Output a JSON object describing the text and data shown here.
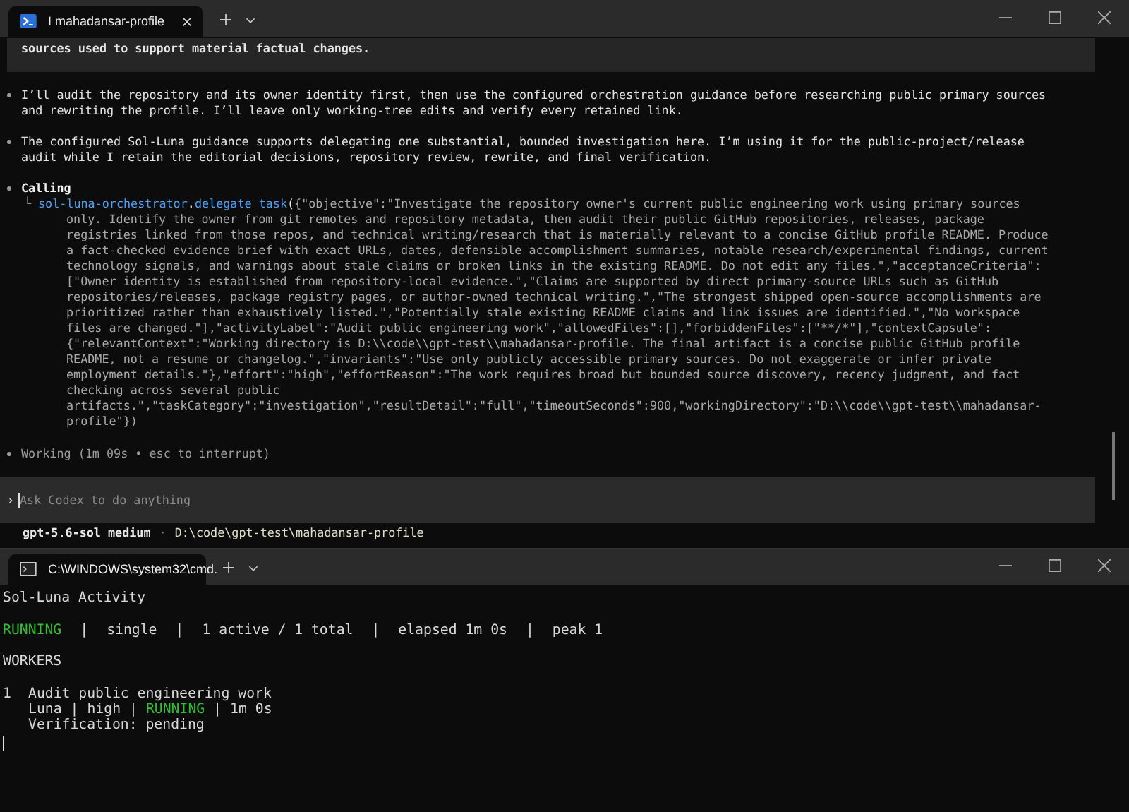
{
  "top_window": {
    "tabs": [
      {
        "kind": "powershell",
        "title": "I mahadansar-profile",
        "selected": true
      }
    ],
    "transcript": [
      {
        "kind": "quote",
        "lines": [
          "sources used to support material factual changes."
        ]
      },
      {
        "kind": "message",
        "lines": [
          "I’ll audit the repository and its owner identity first, then use the configured orchestration guidance before researching public primary sources",
          "and rewriting the profile. I’ll leave only working-tree edits and verify every retained link."
        ]
      },
      {
        "kind": "message",
        "lines": [
          "The configured Sol-Luna guidance supports delegating one substantial, bounded investigation here. I’m using it for the public-project/release",
          "audit while I retain the editorial decisions, repository review, rewrite, and final verification."
        ]
      },
      {
        "kind": "call",
        "label": "Calling",
        "branch": "└",
        "tool": "sol-luna-orchestrator",
        "dot": ".",
        "method": "delegate_task",
        "paren": "(",
        "lines": [
          "{\"objective\":\"Investigate the repository owner's current public engineering work using primary sources",
          "only. Identify the owner from git remotes and repository metadata, then audit their public GitHub repositories, releases, package",
          "registries linked from those repos, and technical writing/research that is materially relevant to a concise GitHub profile README. Produce",
          "a fact-checked evidence brief with exact URLs, dates, defensible accomplishment summaries, notable research/experimental findings, current",
          "technology signals, and warnings about stale claims or broken links in the existing README. Do not edit any files.\",\"acceptanceCriteria\":",
          "[\"Owner identity is established from repository-local evidence.\",\"Claims are supported by direct primary-source URLs such as GitHub",
          "repositories/releases, package registry pages, or author-owned technical writing.\",\"The strongest shipped open-source accomplishments are",
          "prioritized rather than exhaustively listed.\",\"Potentially stale existing README claims and link issues are identified.\",\"No workspace",
          "files are changed.\"],\"activityLabel\":\"Audit public engineering work\",\"allowedFiles\":[],\"forbiddenFiles\":[\"**/*\"],\"contextCapsule\":",
          "{\"relevantContext\":\"Working directory is D:\\\\code\\\\gpt-test\\\\mahadansar-profile. The final artifact is a concise public GitHub profile",
          "README, not a resume or changelog.\",\"invariants\":\"Use only publicly accessible primary sources. Do not exaggerate or infer private",
          "employment details.\"},\"effort\":\"high\",\"effortReason\":\"The work requires broad but bounded source discovery, recency judgment, and fact",
          "checking across several public",
          "artifacts.\",\"taskCategory\":\"investigation\",\"resultDetail\":\"full\",\"timeoutSeconds\":900,\"workingDirectory\":\"D:\\\\code\\\\gpt-test\\\\mahadansar-",
          "profile\"})"
        ]
      },
      {
        "kind": "status",
        "lines": [
          "Working (1m 09s • esc to interrupt)"
        ]
      }
    ],
    "prompt": {
      "chevron": "›",
      "placeholder": "Ask Codex to do anything"
    },
    "footer": {
      "model": "gpt-5.6-sol medium",
      "separator": "·",
      "path": "D:\\code\\gpt-test\\mahadansar-profile"
    }
  },
  "bottom_window": {
    "tabs": [
      {
        "kind": "cmd",
        "title": "C:\\WINDOWS\\system32\\cmd.",
        "selected": true
      }
    ],
    "heading": "Sol-Luna Activity",
    "summary": [
      {
        "text": "RUNNING",
        "kind": "status"
      },
      {
        "text": "|",
        "kind": "sep"
      },
      {
        "text": "single",
        "kind": "plain"
      },
      {
        "text": "|",
        "kind": "sep"
      },
      {
        "text": "1 active / 1 total",
        "kind": "plain"
      },
      {
        "text": "|",
        "kind": "sep"
      },
      {
        "text": "elapsed 1m 0s",
        "kind": "plain"
      },
      {
        "text": "|",
        "kind": "sep"
      },
      {
        "text": "peak 1",
        "kind": "plain"
      }
    ],
    "section": "WORKERS",
    "workers": [
      {
        "index": "1",
        "title": "Audit public engineering work",
        "meta": [
          {
            "text": "Luna",
            "kind": "plain"
          },
          {
            "text": "|",
            "kind": "sep"
          },
          {
            "text": "high",
            "kind": "plain"
          },
          {
            "text": "|",
            "kind": "sep"
          },
          {
            "text": "RUNNING",
            "kind": "status"
          },
          {
            "text": "|",
            "kind": "sep"
          },
          {
            "text": "1m 0s",
            "kind": "plain"
          }
        ],
        "verification": "Verification: pending"
      }
    ]
  }
}
